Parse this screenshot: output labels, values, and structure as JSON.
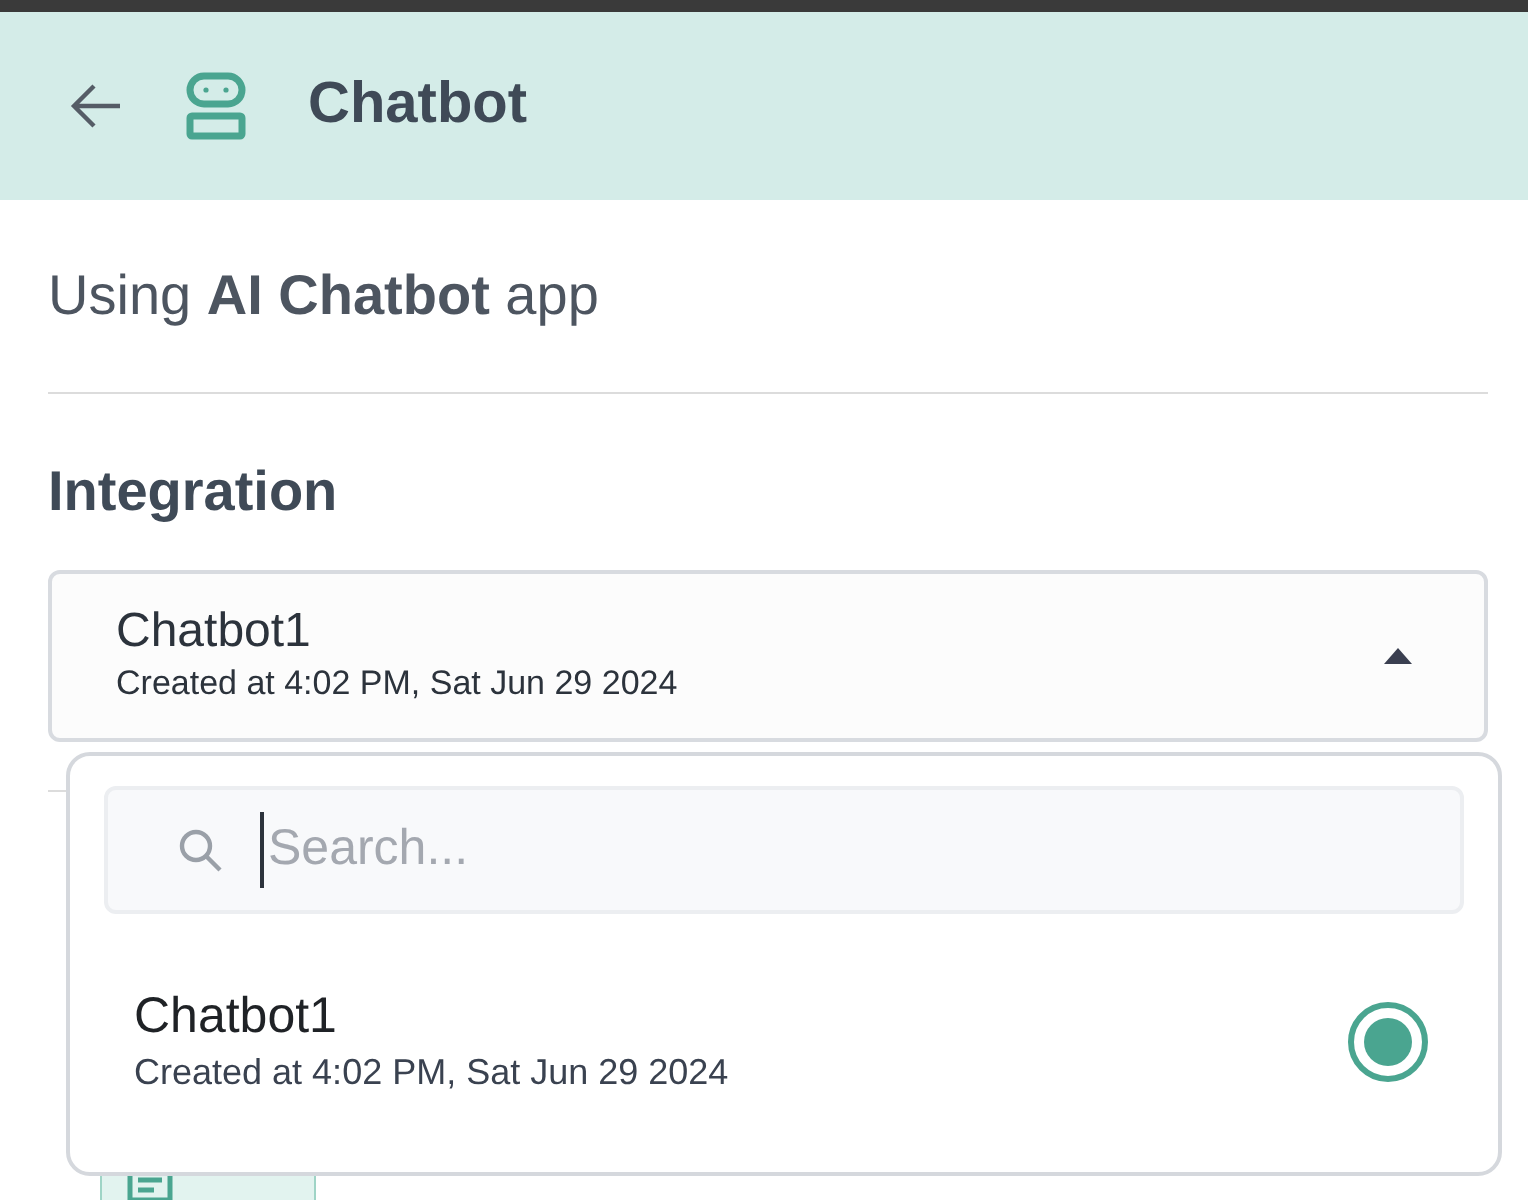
{
  "header": {
    "title": "Chatbot"
  },
  "intro": "Using **AI Chatbot** app",
  "integration": {
    "heading": "Integration",
    "selected_name": "Chatbot1",
    "selected_created": "Created at 4:02 PM, Sat Jun 29 2024",
    "expanded": true
  },
  "dropdown": {
    "search_placeholder": "Search...",
    "options": [
      {
        "name": "Chatbot1",
        "created": "Created at 4:02 PM, Sat Jun 29 2024",
        "selected": true
      }
    ]
  }
}
